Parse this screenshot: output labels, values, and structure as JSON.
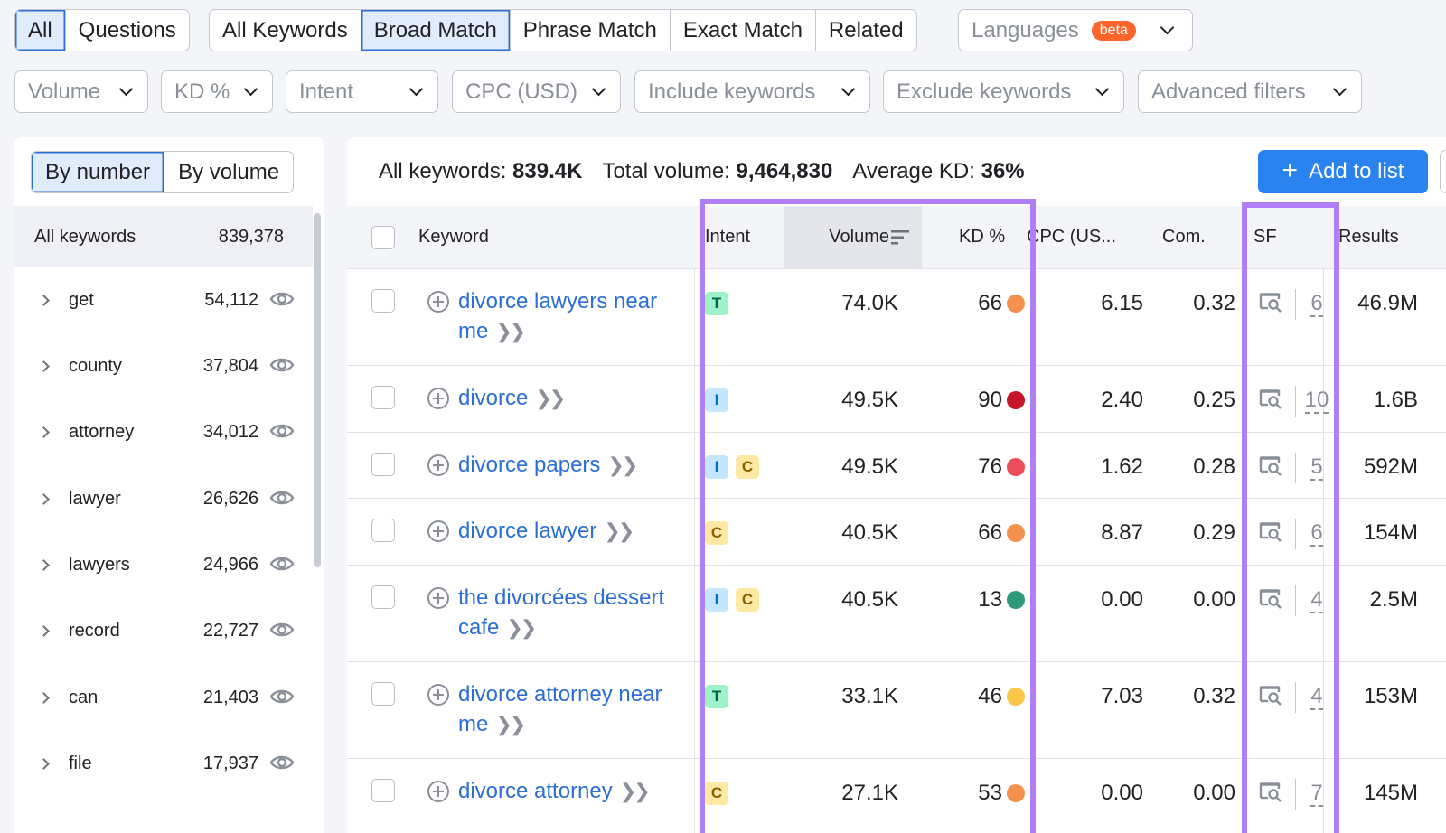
{
  "search_type": {
    "all": "All",
    "questions": "Questions"
  },
  "match_type": {
    "all_keywords": "All Keywords",
    "broad": "Broad Match",
    "phrase": "Phrase Match",
    "exact": "Exact Match",
    "related": "Related"
  },
  "languages": {
    "label": "Languages",
    "badge": "beta"
  },
  "filters": {
    "volume": "Volume",
    "kd": "KD %",
    "intent": "Intent",
    "cpc": "CPC (USD)",
    "include": "Include keywords",
    "exclude": "Exclude keywords",
    "advanced": "Advanced filters"
  },
  "sidebar": {
    "by_number": "By number",
    "by_volume": "By volume",
    "all_label": "All keywords",
    "all_count": "839,378",
    "groups": [
      {
        "word": "get",
        "count": "54,112"
      },
      {
        "word": "county",
        "count": "37,804"
      },
      {
        "word": "attorney",
        "count": "34,012"
      },
      {
        "word": "lawyer",
        "count": "26,626"
      },
      {
        "word": "lawyers",
        "count": "24,966"
      },
      {
        "word": "record",
        "count": "22,727"
      },
      {
        "word": "can",
        "count": "21,403"
      },
      {
        "word": "file",
        "count": "17,937"
      }
    ]
  },
  "summary": {
    "all_label": "All keywords:",
    "all_value": "839.4K",
    "total_label": "Total volume:",
    "total_value": "9,464,830",
    "kd_label": "Average KD:",
    "kd_value": "36%"
  },
  "add_to_list": "Add to list",
  "columns": {
    "keyword": "Keyword",
    "intent": "Intent",
    "volume": "Volume",
    "kd": "KD %",
    "cpc": "CPC (US...",
    "com": "Com.",
    "sf": "SF",
    "results": "Results"
  },
  "rows": [
    {
      "kw1": "divorce lawyers near",
      "kw2": "me",
      "intent": [
        "T"
      ],
      "volume": "74.0K",
      "kd": "66",
      "kd_color": "#f4914f",
      "cpc": "6.15",
      "com": "0.32",
      "sf": "6",
      "results": "46.9M"
    },
    {
      "kw1": "divorce",
      "kw2": "",
      "intent": [
        "I"
      ],
      "volume": "49.5K",
      "kd": "90",
      "kd_color": "#c4172c",
      "cpc": "2.40",
      "com": "0.25",
      "sf": "10",
      "results": "1.6B"
    },
    {
      "kw1": "divorce papers",
      "kw2": "",
      "intent": [
        "I",
        "C"
      ],
      "volume": "49.5K",
      "kd": "76",
      "kd_color": "#ed4d5a",
      "cpc": "1.62",
      "com": "0.28",
      "sf": "5",
      "results": "592M"
    },
    {
      "kw1": "divorce lawyer",
      "kw2": "",
      "intent": [
        "C"
      ],
      "volume": "40.5K",
      "kd": "66",
      "kd_color": "#f4914f",
      "cpc": "8.87",
      "com": "0.29",
      "sf": "6",
      "results": "154M"
    },
    {
      "kw1": "the divorcées dessert",
      "kw2": "cafe",
      "intent": [
        "I",
        "C"
      ],
      "volume": "40.5K",
      "kd": "13",
      "kd_color": "#2e9a7a",
      "cpc": "0.00",
      "com": "0.00",
      "sf": "4",
      "results": "2.5M"
    },
    {
      "kw1": "divorce attorney near",
      "kw2": "me",
      "intent": [
        "T"
      ],
      "volume": "33.1K",
      "kd": "46",
      "kd_color": "#f9c647",
      "cpc": "7.03",
      "com": "0.32",
      "sf": "4",
      "results": "153M"
    },
    {
      "kw1": "divorce attorney",
      "kw2": "",
      "intent": [
        "C"
      ],
      "volume": "27.1K",
      "kd": "53",
      "kd_color": "#f4914f",
      "cpc": "0.00",
      "com": "0.00",
      "sf": "7",
      "results": "145M"
    }
  ],
  "colors": {
    "accent": "#2a82ee",
    "link": "#2a6ed6",
    "highlight": "#b27ef5"
  },
  "icons": {
    "eye": "eye-icon",
    "serp": "serp-feature-icon",
    "sort": "sort-icon",
    "expand": "chevron-right-icon",
    "dropdown": "chevron-down-icon",
    "add": "add-keyword-icon"
  }
}
